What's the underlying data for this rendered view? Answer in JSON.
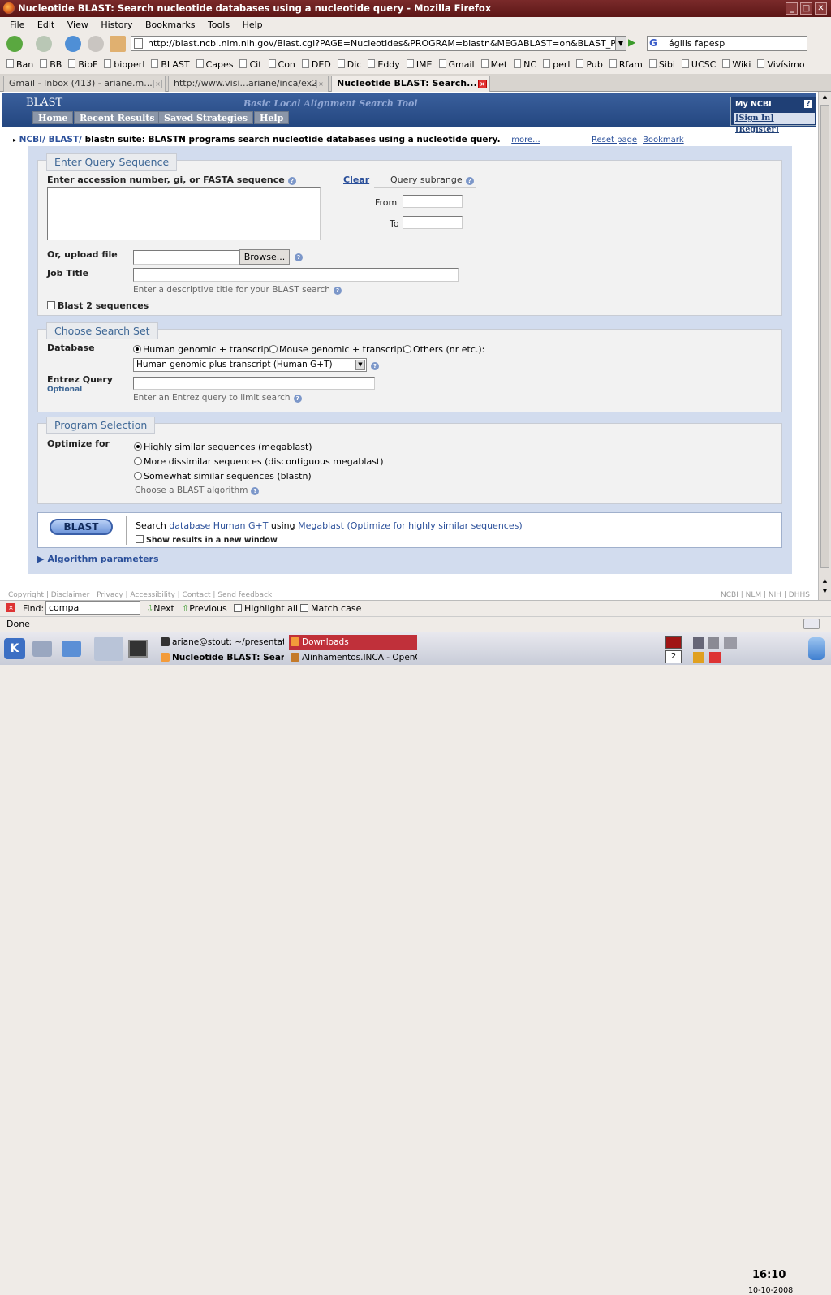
{
  "window": {
    "title": "Nucleotide BLAST: Search nucleotide databases using a nucleotide query - Mozilla Firefox"
  },
  "menu": [
    "File",
    "Edit",
    "View",
    "History",
    "Bookmarks",
    "Tools",
    "Help"
  ],
  "url": "http://blast.ncbi.nlm.nih.gov/Blast.cgi?PAGE=Nucleotides&PROGRAM=blastn&MEGABLAST=on&BLAST_PROGRAMS=",
  "search_box": "ágilis fapesp",
  "bookmarks": [
    "Ban",
    "BB",
    "BibF",
    "bioperl",
    "BLAST",
    "Capes",
    "Cit",
    "Con",
    "DED",
    "Dic",
    "Eddy",
    "IME",
    "Gmail",
    "Met",
    "NC",
    "perl",
    "Pub",
    "Rfam",
    "Sibi",
    "UCSC",
    "Wiki",
    "Vivísimo"
  ],
  "tabs": [
    "Gmail - Inbox (413) - ariane.m...",
    "http://www.visi...ariane/inca/ex2",
    "Nucleotide BLAST: Search..."
  ],
  "header": {
    "logo": "BLAST",
    "tagline": "Basic Local Alignment Search Tool",
    "nav": [
      "Home",
      "Recent Results",
      "Saved Strategies",
      "Help"
    ],
    "myncbi_title": "My NCBI",
    "myncbi_help": "?",
    "sign_in": "[Sign In]",
    "register": "[Register]"
  },
  "breadcrumb": {
    "ncbi": "NCBI/",
    "blast": "BLAST/",
    "text": "blastn suite: BLASTN programs search nucleotide databases using a nucleotide query.",
    "more": "more...",
    "reset": "Reset page",
    "bookmark": "Bookmark"
  },
  "query": {
    "legend": "Enter Query Sequence",
    "label": "Enter accession number, gi, or FASTA sequence",
    "clear": "Clear",
    "subrange": "Query subrange",
    "from": "From",
    "to": "To",
    "upload": "Or, upload file",
    "browse": "Browse...",
    "job_title": "Job Title",
    "job_hint": "Enter a descriptive title for your BLAST search",
    "blast2": "Blast 2 sequences"
  },
  "searchset": {
    "legend": "Choose Search Set",
    "database": "Database",
    "opts": [
      "Human genomic + transcript",
      "Mouse genomic + transcript",
      "Others (nr etc.):"
    ],
    "select": "Human genomic plus transcript (Human G+T)",
    "entrez": "Entrez Query",
    "optional": "Optional",
    "entrez_hint": "Enter an Entrez query to limit search"
  },
  "program": {
    "legend": "Program Selection",
    "optimize": "Optimize for",
    "opts": [
      "Highly similar sequences (megablast)",
      "More dissimilar sequences (discontiguous megablast)",
      "Somewhat similar sequences (blastn)"
    ],
    "choose": "Choose a BLAST algorithm"
  },
  "submit": {
    "button": "BLAST",
    "s1": "Search",
    "s2": "database Human G+T",
    "s3": "using",
    "s4": "Megablast (Optimize for highly similar sequences)",
    "newwin": "Show results in a new window"
  },
  "algo": "Algorithm parameters",
  "footer_left": "Copyright | Disclaimer | Privacy | Accessibility | Contact | Send feedback",
  "footer_right": "NCBI | NLM | NIH | DHHS",
  "findbar": {
    "label": "Find:",
    "value": "compa",
    "next": "Next",
    "previous": "Previous",
    "highlight": "Highlight all",
    "match": "Match case"
  },
  "status": "Done",
  "taskbar": {
    "t1": "ariane@stout: ~/presentat",
    "t2": "Downloads",
    "t3": "Nucleotide BLAST: Search",
    "t4": "Alinhamentos.INCA - OpenO",
    "desk": "2",
    "time": "16:10",
    "date": "10-10-2008"
  }
}
